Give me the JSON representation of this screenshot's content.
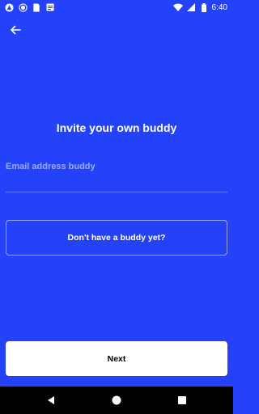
{
  "status_bar": {
    "time": "6:40"
  },
  "screen": {
    "title": "Invite your own buddy",
    "email_placeholder": "Email address buddy",
    "no_buddy_label": "Don't have a buddy yet?",
    "next_label": "Next"
  },
  "colors": {
    "background": "#2342F9",
    "button_bg": "#FFFFFF",
    "text": "#FFFFFF"
  }
}
